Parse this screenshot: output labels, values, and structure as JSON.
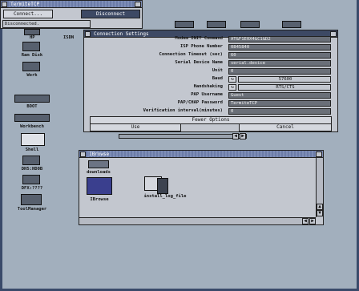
{
  "miami_window": {
    "title": "TermiteTCP",
    "connect_label": "Connect...",
    "disconnect_label": "Disconnect",
    "status": "Disconnected."
  },
  "desktop_icons": [
    {
      "id": "ram-disk",
      "label": "Ram Disk"
    },
    {
      "id": "work",
      "label": "Work"
    },
    {
      "id": "boot",
      "label": "BOOT"
    },
    {
      "id": "workbench",
      "label": "Workbench"
    },
    {
      "id": "shell",
      "label": "Shell"
    },
    {
      "id": "dh5",
      "label": "DH5:HD0B"
    },
    {
      "id": "dfx",
      "label": "DFX:????"
    },
    {
      "id": "toolmanager",
      "label": "ToolManager"
    }
  ],
  "partial_labels": {
    "hp": "HP",
    "isdn": "ISDN"
  },
  "settings_window": {
    "title": "Connection Settings",
    "rows": [
      {
        "label": "Modem INIT Command",
        "value": "AT&F1E0X4&C1&D2"
      },
      {
        "label": "ISP Phone Number",
        "value": "0845840"
      },
      {
        "label": "Connection Timeout (sec)",
        "value": "60"
      },
      {
        "label": "Serial Device Name",
        "value": "serial.device"
      },
      {
        "label": "Unit",
        "value": "0"
      },
      {
        "label": "Baud",
        "value": "57600"
      },
      {
        "label": "Handshaking",
        "value": "RTS/CTS"
      },
      {
        "label": "PAP Username",
        "value": "Guest"
      },
      {
        "label": "PAP/CHAP Password",
        "value": "TermiteTCP"
      },
      {
        "label": "Verification interval(minutes)",
        "value": "0"
      }
    ],
    "fewer_options_label": "Fewer Options",
    "use_label": "Use",
    "cancel_label": "Cancel"
  },
  "ibrowse_window": {
    "title": "IBrowse",
    "icons": [
      {
        "id": "downloads",
        "label": "downloads"
      },
      {
        "id": "ibrowse",
        "label": "IBrowse"
      },
      {
        "id": "install-log",
        "label": "install_log_file"
      }
    ]
  }
}
